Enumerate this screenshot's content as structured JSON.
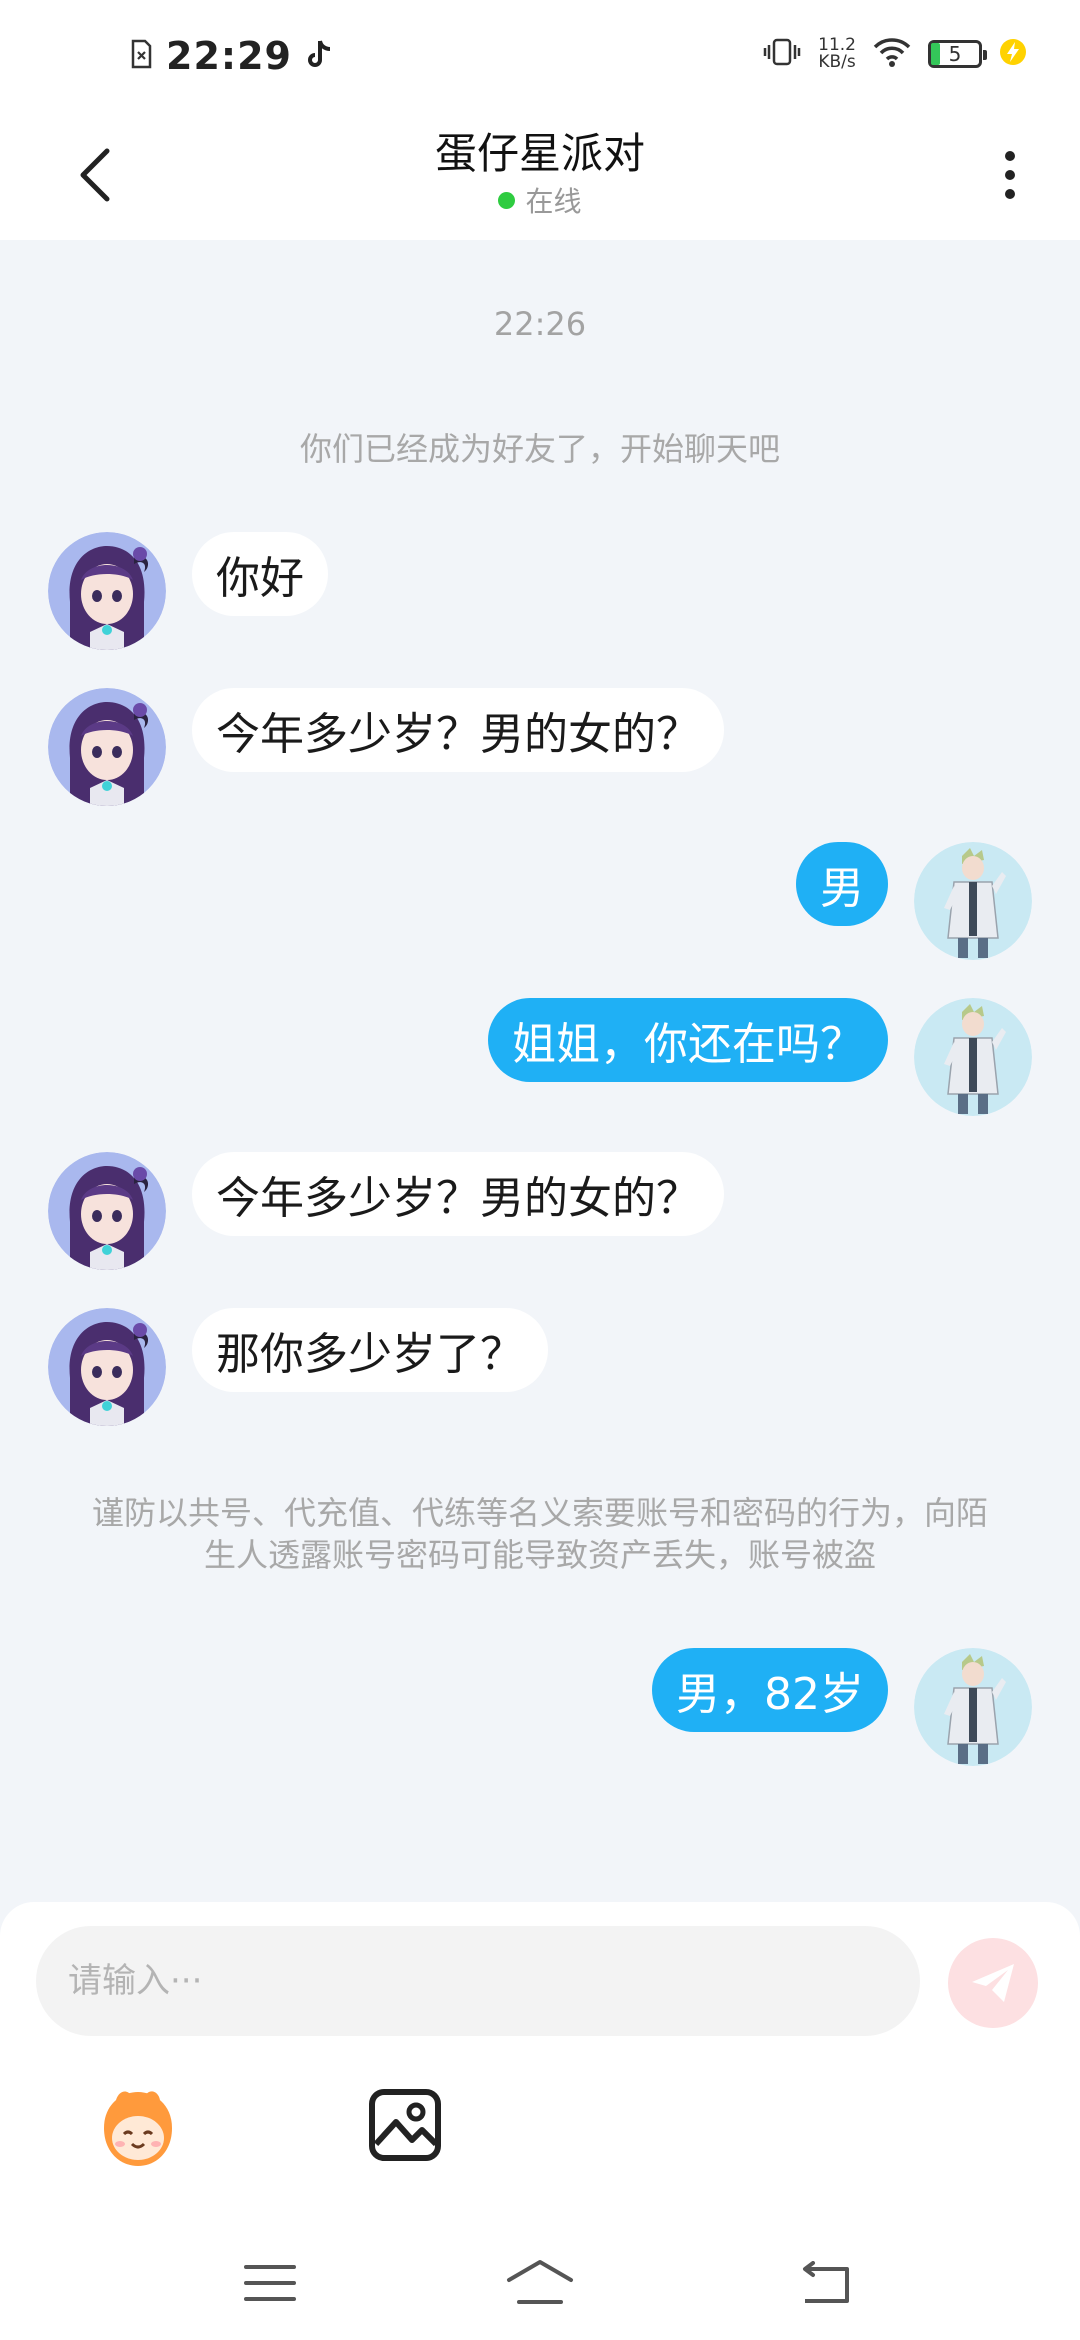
{
  "status_bar": {
    "time": "22:29",
    "net_speed_value": "11.2",
    "net_speed_unit": "KB/s",
    "battery_level": "5",
    "battery_fill_percent": 5
  },
  "header": {
    "title": "蛋仔星派对",
    "status": "在线"
  },
  "chat": {
    "time_label": "22:26",
    "system_message": "你们已经成为好友了，开始聊天吧",
    "warning_message": "谨防以共号、代充值、代练等名义索要账号和密码的行为，向陌生人透露账号密码可能导致资产丢失，账号被盗",
    "messages": [
      {
        "side": "left",
        "text": "你好"
      },
      {
        "side": "left",
        "text": "今年多少岁？男的女的？"
      },
      {
        "side": "right",
        "text": "男"
      },
      {
        "side": "right",
        "text": "姐姐，你还在吗？"
      },
      {
        "side": "left",
        "text": "今年多少岁？男的女的？"
      },
      {
        "side": "left",
        "text": "那你多少岁了？"
      },
      {
        "side": "right",
        "text": "男，82岁"
      }
    ]
  },
  "input": {
    "placeholder": "请输入···"
  },
  "icons": {
    "back": "back-arrow-icon",
    "more": "more-vertical-icon",
    "send": "send-icon",
    "emoji": "eggy-emoji-icon",
    "image": "image-icon"
  },
  "colors": {
    "sent_bubble": "#1fb0f5",
    "received_bubble": "#ffffff",
    "chat_background": "#f2f5f9",
    "online_dot": "#2ecc40",
    "send_button": "#fde0e2"
  }
}
